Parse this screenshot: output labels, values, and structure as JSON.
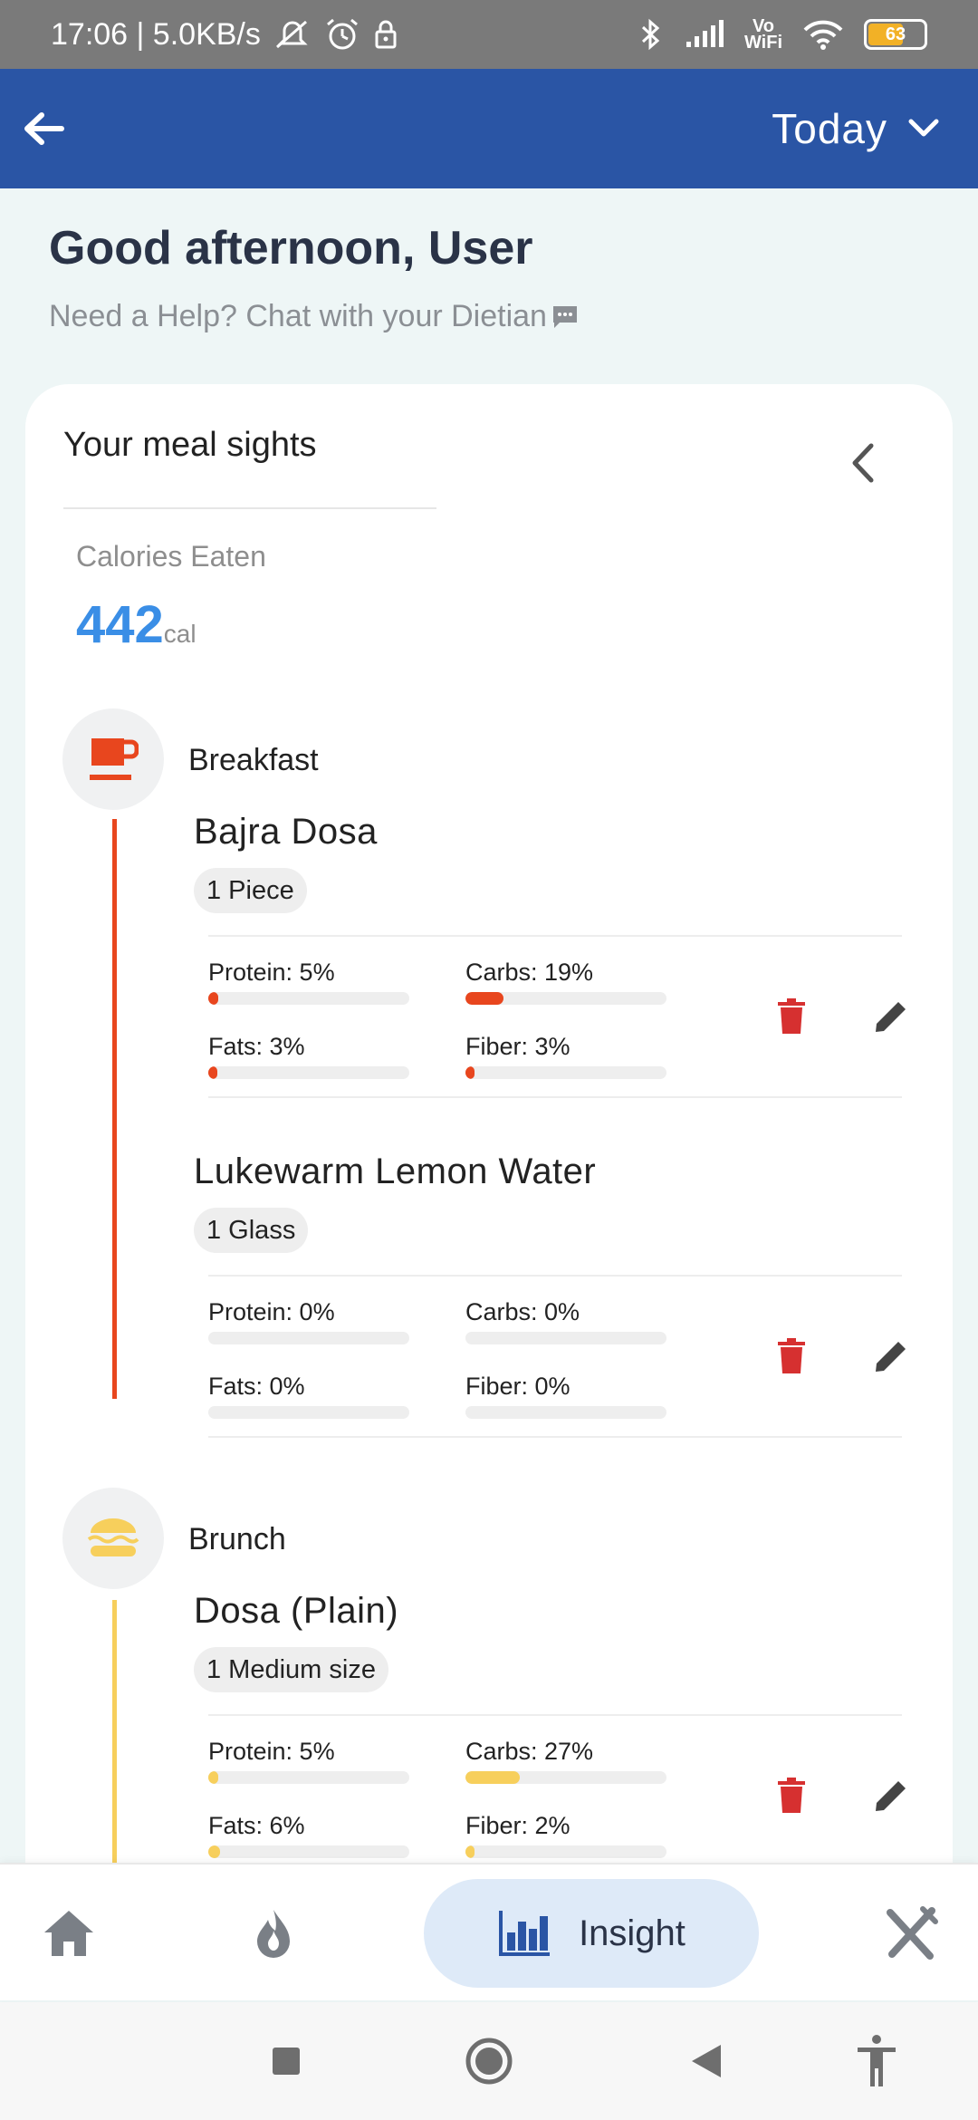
{
  "status": {
    "time_speed": "17:06 | 5.0KB/s",
    "battery": "63",
    "vowifi_top": "Vo",
    "vowifi_bottom": "WiFi"
  },
  "header": {
    "date_filter": "Today"
  },
  "greeting": {
    "title": "Good afternoon, User",
    "help_text": "Need a Help? Chat with your Dietian"
  },
  "card": {
    "title": "Your meal sights",
    "calories_label": "Calories Eaten",
    "calories_value": "442",
    "calories_unit": "cal"
  },
  "meals": [
    {
      "name": "Breakfast",
      "color": "#e8461e",
      "foods": [
        {
          "name": "Bajra Dosa",
          "quantity": "1 Piece",
          "protein_label": "Protein: 5%",
          "protein": 5,
          "carbs_label": "Carbs: 19%",
          "carbs": 19,
          "fats_label": "Fats: 3%",
          "fats": 3,
          "fiber_label": "Fiber: 3%",
          "fiber": 3
        },
        {
          "name": "Lukewarm Lemon Water",
          "quantity": "1 Glass",
          "protein_label": "Protein: 0%",
          "protein": 0,
          "carbs_label": "Carbs: 0%",
          "carbs": 0,
          "fats_label": "Fats: 0%",
          "fats": 0,
          "fiber_label": "Fiber: 0%",
          "fiber": 0
        }
      ]
    },
    {
      "name": "Brunch",
      "color": "#f7cf5c",
      "foods": [
        {
          "name": "Dosa (Plain)",
          "quantity": "1 Medium size",
          "protein_label": "Protein: 5%",
          "protein": 5,
          "carbs_label": "Carbs: 27%",
          "carbs": 27,
          "fats_label": "Fats: 6%",
          "fats": 6,
          "fiber_label": "Fiber: 2%",
          "fiber": 2
        }
      ]
    }
  ],
  "nav": {
    "insight_label": "Insight"
  },
  "colors": {
    "appbar": "#2a55a5",
    "accent_blue": "#3a8ee6",
    "delete": "#d63030",
    "edit": "#444444"
  }
}
